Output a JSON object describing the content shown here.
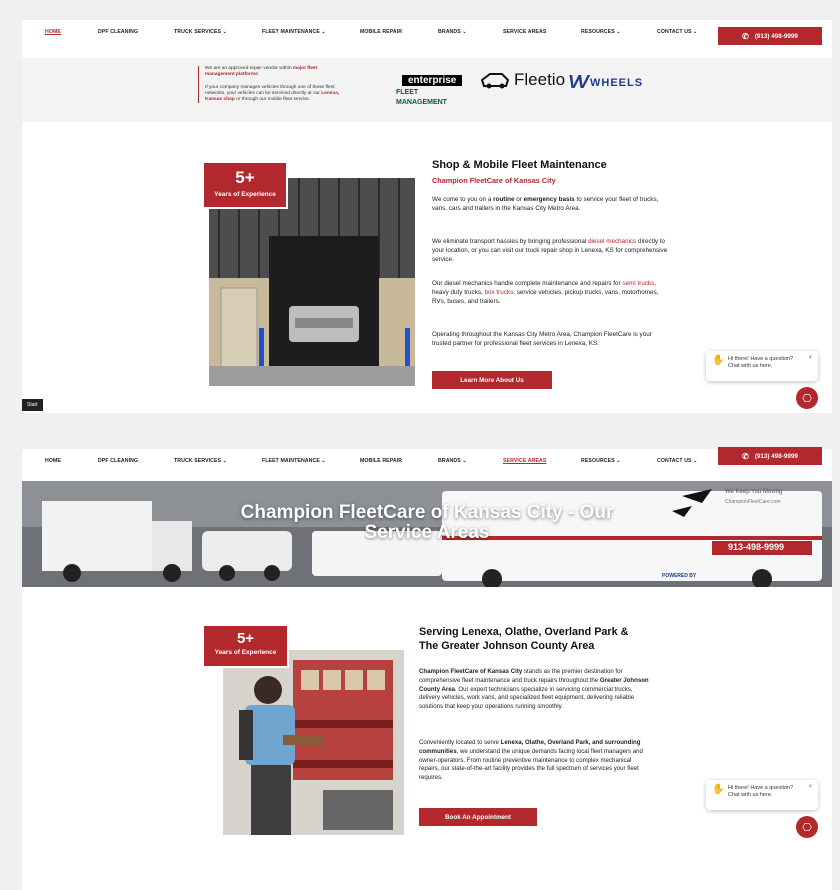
{
  "nav": {
    "items": [
      {
        "label": "HOME"
      },
      {
        "label": "DPF CLEANING"
      },
      {
        "label": "TRUCK SERVICES ⌄"
      },
      {
        "label": "FLEET MAINTENANCE ⌄"
      },
      {
        "label": "MOBILE REPAIR"
      },
      {
        "label": "BRANDS ⌄"
      },
      {
        "label": "SERVICE AREAS"
      },
      {
        "label": "RESOURCES ⌄"
      },
      {
        "label": "CONTACT US ⌄"
      }
    ],
    "phone": "(913) 498-9999"
  },
  "band": {
    "line1_pre": "We are an approved repair vendor within ",
    "line1_bold": "major fleet management platforms",
    "line1_post": ".",
    "line2_pre": "If your company manages vehicles through one of these fleet networks, your vehicles can be serviced directly at our ",
    "line2_bold": "Lenexa, Kansas shop",
    "line2_post": " or through our mobile fleet service.",
    "logos": {
      "enterprise_top": "enterprise",
      "enterprise_bottom": "FLEET MANAGEMENT",
      "fleetio": "Fleetio",
      "wheels": "WHEELS"
    }
  },
  "section1": {
    "badge_big": "5+",
    "badge_small": "Years of Experience",
    "title": "Shop & Mobile Fleet Maintenance",
    "subtitle": "Champion FleetCare of Kansas City",
    "p1_a": "We come to you on a ",
    "p1_b": "routine",
    "p1_c": " or ",
    "p1_d": "emergency basis",
    "p1_e": " to service your fleet of trucks, vans, cars and trailers in the Kansas City Metro Area.",
    "p2_a": "We eliminate transport hassles by bringing professional ",
    "p2_link": "diesel mechanics",
    "p2_b": " directly to your location, or you can visit our truck repair shop in Lenexa, KS for comprehensive service.",
    "p3_a": "Our diesel mechanics handle complete maintenance and repairs for ",
    "p3_link1": "semi trucks",
    "p3_b": ", heavy duty trucks, ",
    "p3_link2": "box trucks",
    "p3_c": ", service vehicles, pickup trucks, vans, motorhomes, RVs, buses, and trailers.",
    "p4": "Operating throughout the Kansas City Metro Area, Champion FleetCare is your trusted partner for professional fleet services in Lenexa, KS.",
    "button": "Learn More About Us"
  },
  "chat": {
    "line1": "Hi there! Have a question?",
    "line2": "Chat with us here.",
    "close": "×"
  },
  "start": "Start",
  "hero": {
    "title_line1": "Champion FleetCare of Kansas City - Our",
    "title_line2": "Service Areas",
    "truck_phone": "913-498-9999",
    "truck_text1": "We Keep You Moving",
    "truck_text2": "ChampionFleetCare.com",
    "powered": "POWERED BY"
  },
  "section2": {
    "badge_big": "5+",
    "badge_small": "Years of Experience",
    "title": "Serving Lenexa, Olathe, Overland Park & The Greater Johnson County Area",
    "p1_bold": "Champion FleetCare of Kansas City",
    "p1_a": " stands as the premier destination for comprehensive fleet maintenance and truck repairs throughout the ",
    "p1_bold2": "Greater Johnson County Area",
    "p1_b": ". Our expert technicians specialize in servicing commercial trucks, delivery vehicles, work vans, and specialized fleet equipment, delivering reliable solutions that keep your operations running smoothly.",
    "p2_a": "Conveniently located to serve ",
    "p2_bold": "Lenexa, Olathe, Overland Park, and surrounding communities",
    "p2_b": ", we understand the unique demands facing local fleet managers and owner-operators. From routine preventive maintenance to complex mechanical repairs, our state-of-the-art facility provides the full spectrum of services your fleet requires.",
    "button": "Book An Appointment"
  }
}
